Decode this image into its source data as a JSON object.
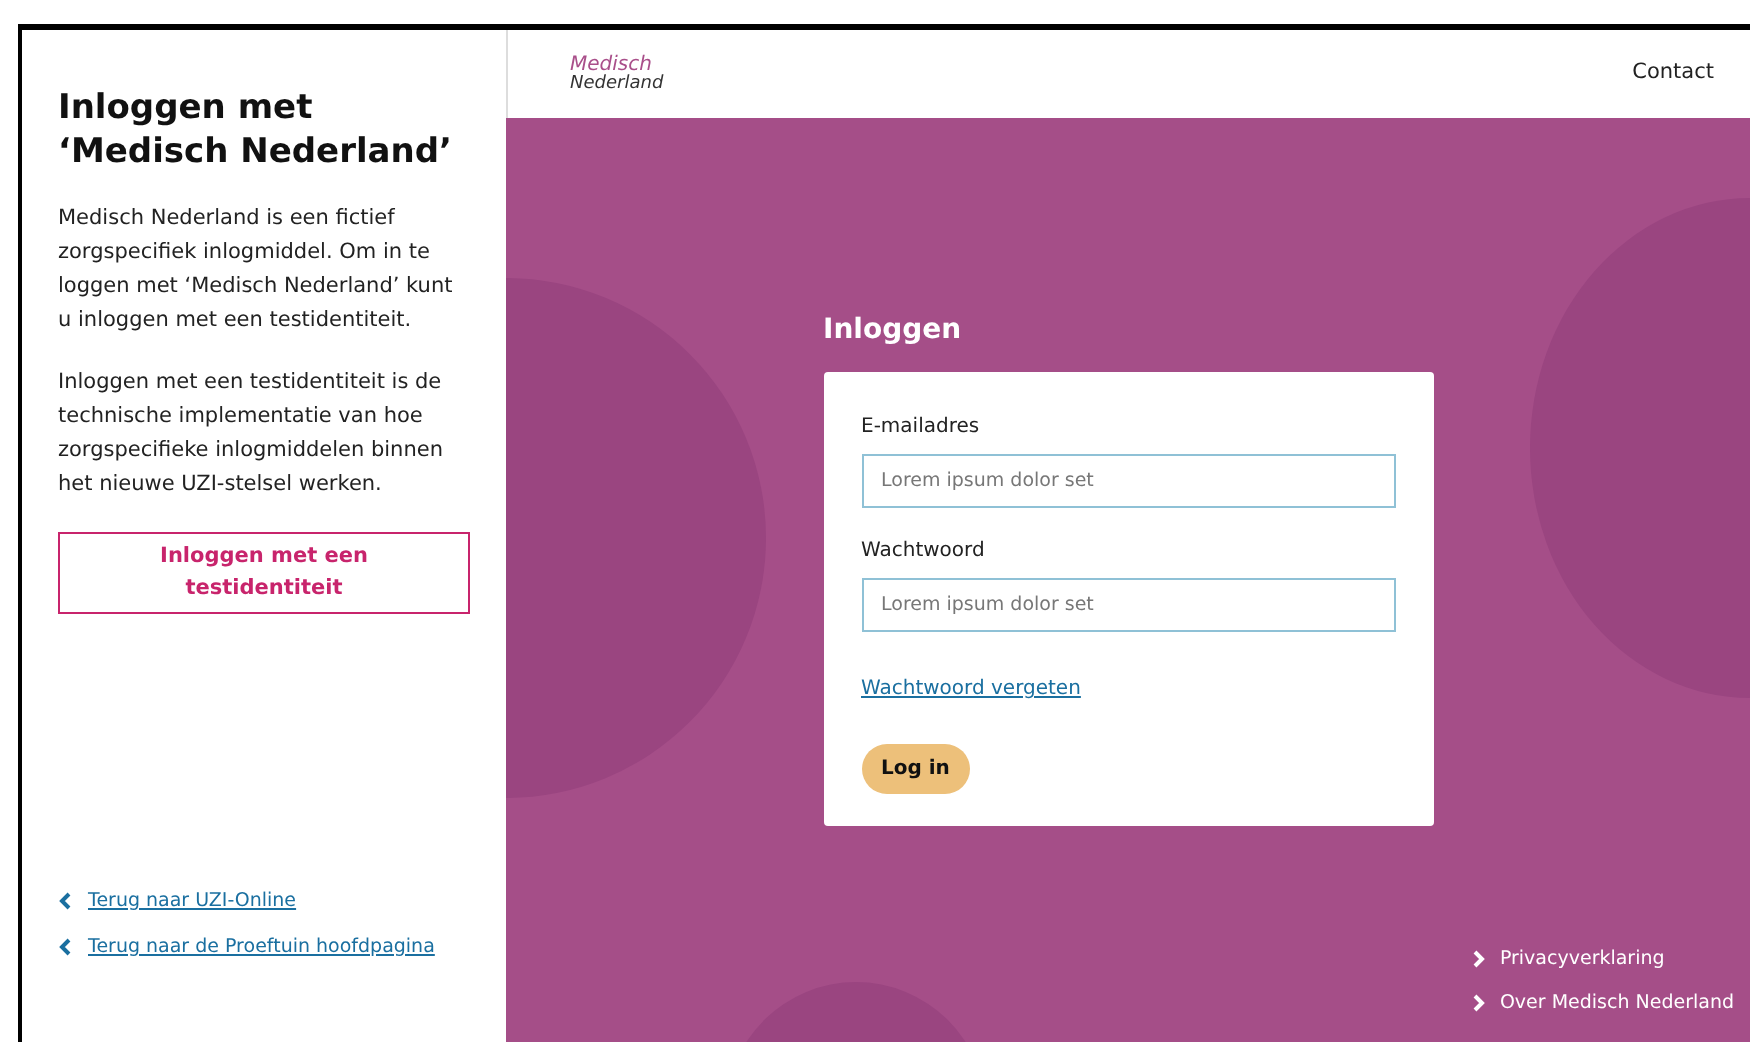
{
  "sidebar": {
    "title": "Inloggen met ‘Medisch Nederland’",
    "paragraphs": [
      "Medisch Nederland is een fictief zorgspecifiek inlogmiddel. Om in te loggen met ‘Medisch Nederland’ kunt u inloggen met een testidentiteit.",
      "Inloggen met een testidentiteit is de technische implementatie van hoe zorgspecifieke inlogmiddelen binnen het nieuwe UZI-stelsel werken."
    ],
    "button": "Inloggen met een testidentiteit",
    "back_links": [
      "Terug naar UZI-Online",
      "Terug naar de Proeftuin hoofdpagina"
    ]
  },
  "header": {
    "logo": [
      "Medisch",
      "Nederland"
    ],
    "nav": [
      "Contact"
    ]
  },
  "login": {
    "title": "Inloggen",
    "fields": [
      {
        "label": "E-mailadres",
        "placeholder": "Lorem ipsum dolor set"
      },
      {
        "label": "Wachtwoord",
        "placeholder": "Lorem ipsum dolor set"
      }
    ],
    "forgot_link": "Wachtwoord vergeten",
    "submit": "Log in"
  },
  "footer_links": [
    "Privacyverklaring",
    "Over Medisch Nederland"
  ]
}
